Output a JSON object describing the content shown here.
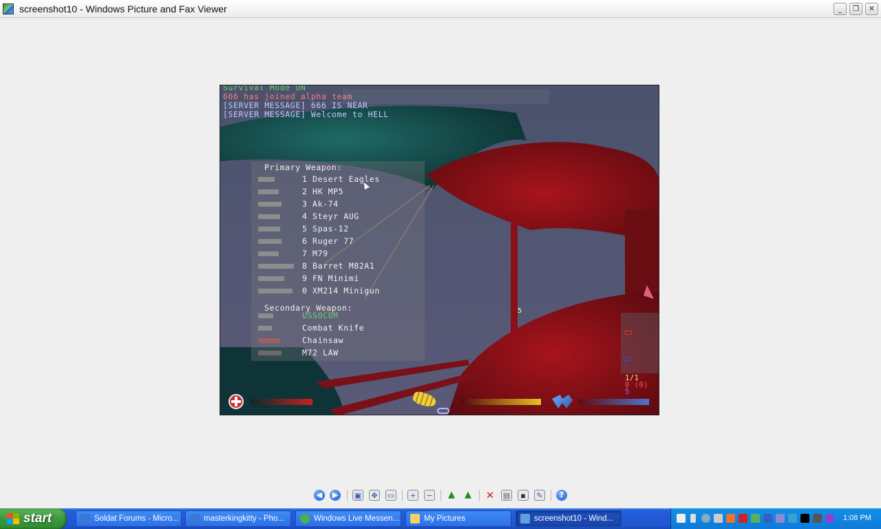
{
  "window": {
    "title": "screenshot10 - Windows Picture and Fax Viewer",
    "buttons": {
      "minimize": "_",
      "maximize": "❐",
      "close": "✕"
    }
  },
  "game": {
    "chat": [
      "Survival Mode ON",
      "666 has joined alpha team",
      "[SERVER MESSAGE] 666 IS NEAR",
      "[SERVER MESSAGE] Welcome to HELL"
    ],
    "primary_header": "Primary Weapon:",
    "primary_weapons": [
      "1 Desert Eagles",
      "2 HK MP5",
      "3 Ak-74",
      "4 Steyr AUG",
      "5 Spas-12",
      "6 Ruger 77",
      "7 M79",
      "8 Barret M82A1",
      "9 FN Minimi",
      "0 XM214 Minigun"
    ],
    "secondary_header": "Secondary Weapon:",
    "secondary_weapons": [
      "USSOCOM",
      "Combat Knife",
      "Chainsaw",
      "M72 LAW"
    ],
    "selected_secondary": "USSOCOM",
    "marker_number": "5",
    "score": {
      "kills": "1/1",
      "deaths": "0 (0)",
      "extra": "5"
    },
    "hud": {
      "health_fraction": 0.78,
      "ammo_fraction": 1.0,
      "jet_fraction": 0.9
    },
    "colors": {
      "health": "#c82020",
      "ammo": "#e8c020",
      "jet": "#4c78c8",
      "selected": "#6fcf6f"
    }
  },
  "toolbar": {
    "icons": [
      "previous-image-icon",
      "next-image-icon",
      "best-fit-icon",
      "actual-size-icon",
      "slideshow-icon",
      "zoom-in-icon",
      "zoom-out-icon",
      "rotate-clockwise-icon",
      "rotate-counterclockwise-icon",
      "delete-icon",
      "print-icon",
      "save-icon",
      "edit-icon",
      "help-icon"
    ]
  },
  "taskbar": {
    "start_label": "start",
    "tasks": [
      {
        "label": "Soldat Forums - Micro...",
        "active": false
      },
      {
        "label": "masterkingkitty - Pho...",
        "active": false
      },
      {
        "label": "Windows Live Messen...",
        "active": false
      },
      {
        "label": "My Pictures",
        "active": false
      },
      {
        "label": "screenshot10 - Wind...",
        "active": true
      }
    ],
    "clock": "1:08 PM"
  }
}
